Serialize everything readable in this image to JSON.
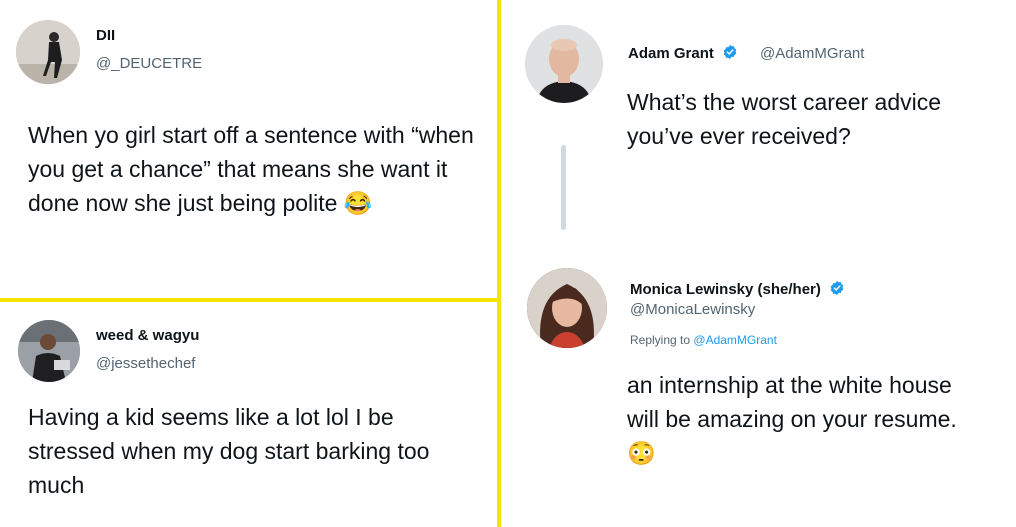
{
  "tweets": [
    {
      "name": "DII",
      "handle": "@_DEUCETRE",
      "text": "When yo girl start off a sentence with “when you get a chance” that means she want it done now she just being polite",
      "emoji": "😂"
    },
    {
      "name": "weed & wagyu",
      "handle": "@jessethechef",
      "text": "Having a kid seems like a lot lol I be stressed when my dog start barking too much"
    },
    {
      "name": "Adam Grant",
      "handle": "@AdamMGrant",
      "text": "What’s the worst career advice you’ve ever received?",
      "verified": true
    },
    {
      "name": "Monica Lewinsky (she/her)",
      "handle": "@MonicaLewinsky",
      "replying_prefix": "Replying to",
      "replying_to": "@AdamMGrant",
      "text": "an internship at the white house will be amazing on your resume.",
      "emoji": "😳",
      "verified": true
    }
  ],
  "colors": {
    "divider": "#f5e300",
    "verified": "#1d9bf0",
    "handle": "#536471",
    "thread_line": "#cfd9de"
  }
}
